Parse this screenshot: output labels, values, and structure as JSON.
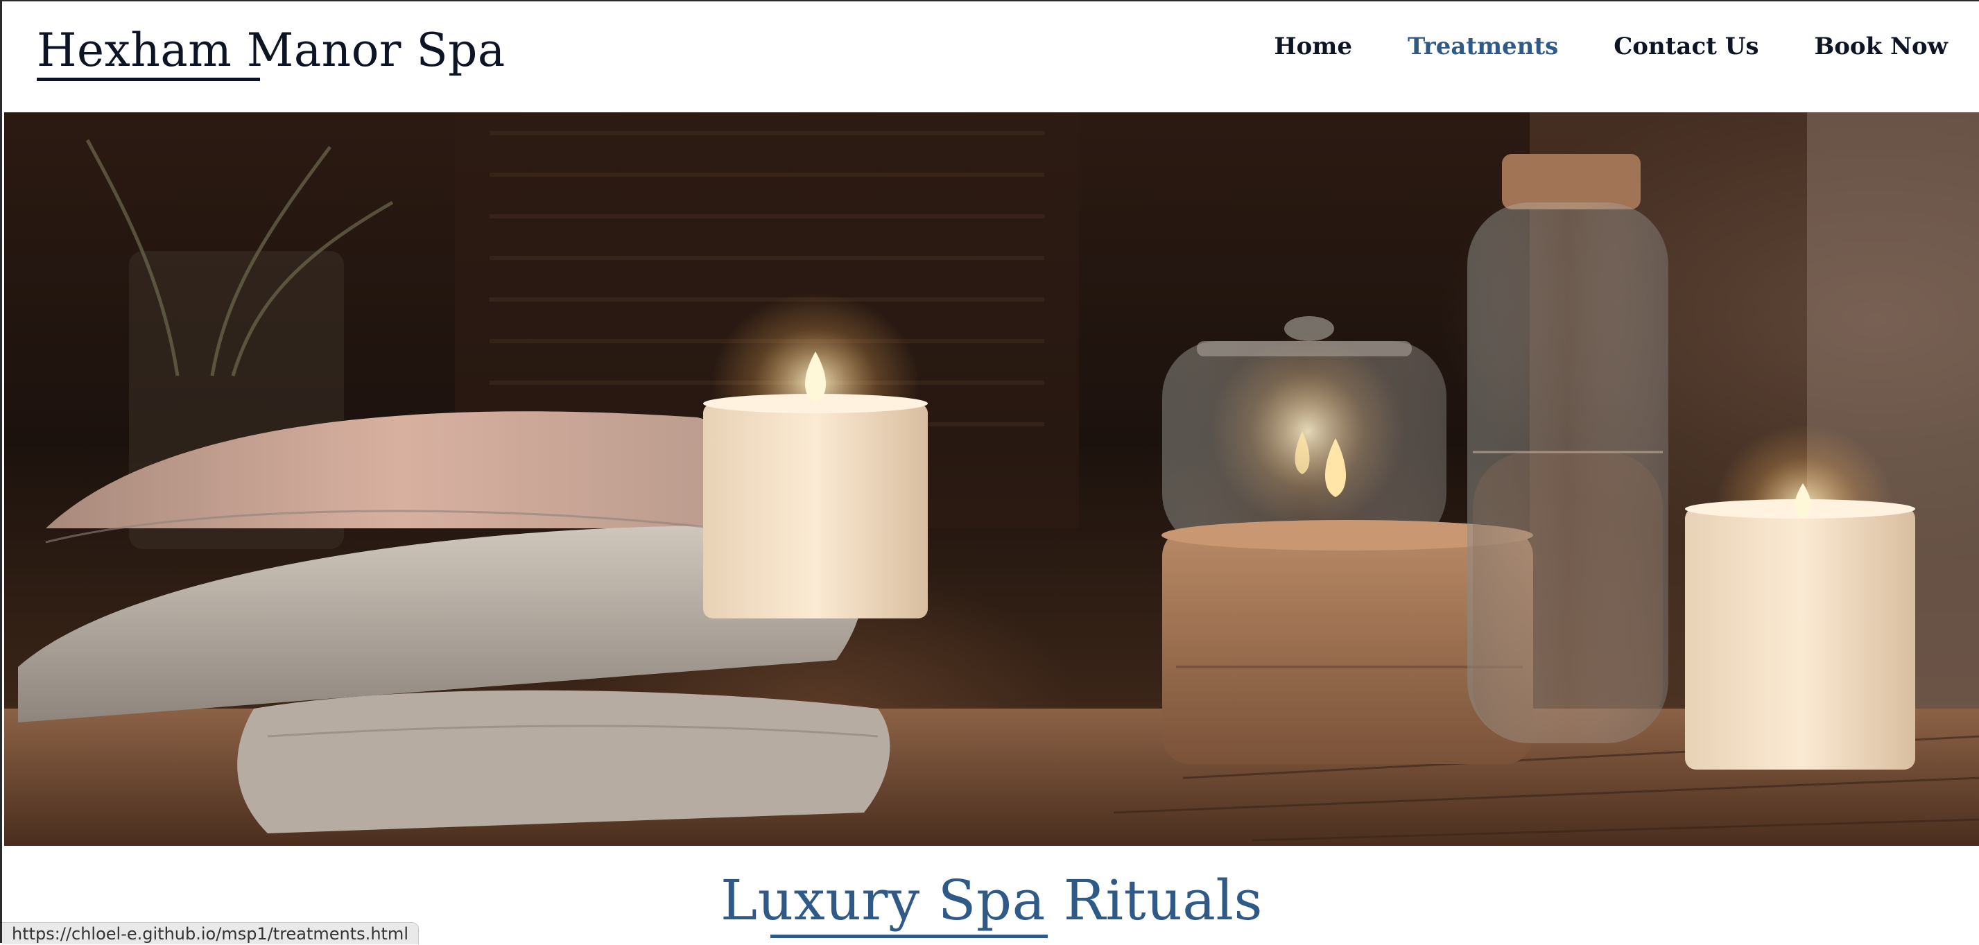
{
  "site": {
    "brand": "Hexham Manor Spa"
  },
  "nav": {
    "items": [
      {
        "label": "Home",
        "active": false
      },
      {
        "label": "Treatments",
        "active": true
      },
      {
        "label": "Contact Us",
        "active": false
      },
      {
        "label": "Book Now",
        "active": false
      }
    ]
  },
  "hero": {
    "image": "spa-candles-towels-photo"
  },
  "section": {
    "title": "Luxury Spa Rituals"
  },
  "status_bar": {
    "url": "https://chloel-e.github.io/msp1/treatments.html"
  },
  "colors": {
    "accent": "#2f5a88",
    "text": "#0d1424",
    "background": "#ffffff"
  }
}
